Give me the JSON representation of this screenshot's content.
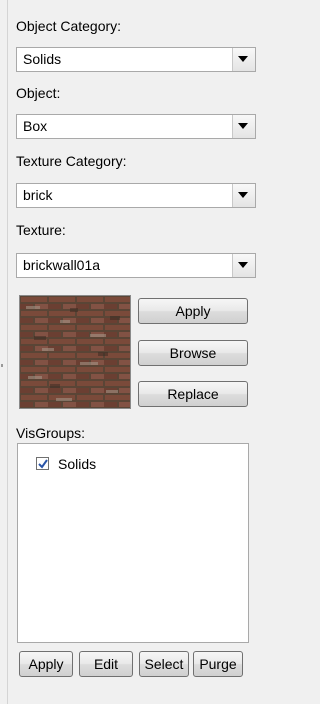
{
  "object_category": {
    "label": "Object Category:",
    "value": "Solids"
  },
  "object": {
    "label": "Object:",
    "value": "Box"
  },
  "texture_category": {
    "label": "Texture Category:",
    "value": "brick"
  },
  "texture": {
    "label": "Texture:",
    "value": "brickwall01a"
  },
  "texture_buttons": {
    "apply": "Apply",
    "browse": "Browse",
    "replace": "Replace"
  },
  "visgroups": {
    "label": "VisGroups:",
    "items": [
      {
        "label": "Solids",
        "checked": true
      }
    ]
  },
  "bottom_buttons": {
    "apply": "Apply",
    "edit": "Edit",
    "select": "Select",
    "purge": "Purge"
  },
  "icons": {
    "dropdown": "chevron-down-icon",
    "check": "check-icon"
  }
}
